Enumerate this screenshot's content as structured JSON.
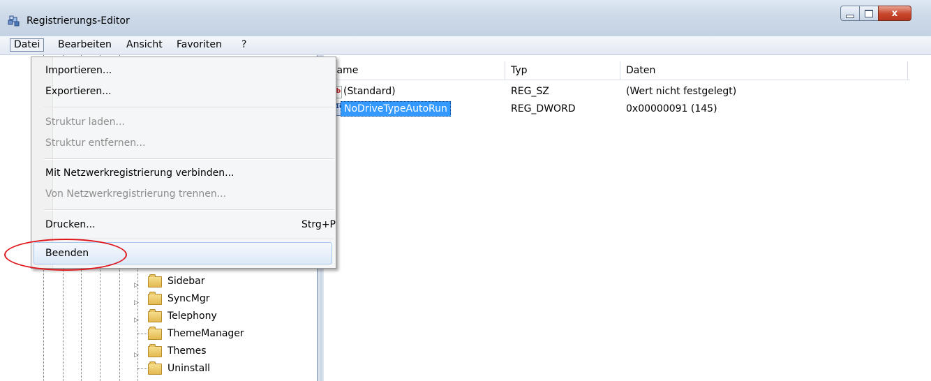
{
  "window": {
    "title": "Registrierungs-Editor",
    "close_glyph": "x",
    "icon": "regedit-icon"
  },
  "menubar": {
    "items": [
      "Datei",
      "Bearbeiten",
      "Ansicht",
      "Favoriten",
      "?"
    ],
    "active": "Datei"
  },
  "file_menu": {
    "items": [
      {
        "label": "Importieren...",
        "enabled": true
      },
      {
        "label": "Exportieren...",
        "enabled": true
      },
      {
        "label": "Struktur laden...",
        "enabled": false
      },
      {
        "label": "Struktur entfernen...",
        "enabled": false
      },
      {
        "label": "Mit Netzwerkregistrierung verbinden...",
        "enabled": true
      },
      {
        "label": "Von Netzwerkregistrierung trennen...",
        "enabled": false
      },
      {
        "label": "Drucken...",
        "enabled": true,
        "shortcut": "Strg+P"
      },
      {
        "label": "Beenden",
        "enabled": true,
        "hovered": true
      }
    ]
  },
  "tree": {
    "items": [
      {
        "label": "Sidebar",
        "expandable": true
      },
      {
        "label": "SyncMgr",
        "expandable": true
      },
      {
        "label": "Telephony",
        "expandable": true
      },
      {
        "label": "ThemeManager",
        "expandable": false
      },
      {
        "label": "Themes",
        "expandable": true
      },
      {
        "label": "Uninstall",
        "expandable": false
      }
    ]
  },
  "values_list": {
    "columns": [
      "Name",
      "Typ",
      "Daten"
    ],
    "rows": [
      {
        "name": "(Standard)",
        "type": "REG_SZ",
        "data": "(Wert nicht festgelegt)",
        "icon": "string-value-icon",
        "icon_text": "ab"
      },
      {
        "name": "NoDriveTypeAutoRun",
        "type": "REG_DWORD",
        "data": "0x00000091 (145)",
        "icon": "binary-value-icon",
        "icon_text": "010",
        "selected": true
      }
    ]
  },
  "colors": {
    "selection": "#3399ff",
    "annotation_circle": "#e0161d",
    "menu_hover_border": "#a8c6ec"
  }
}
